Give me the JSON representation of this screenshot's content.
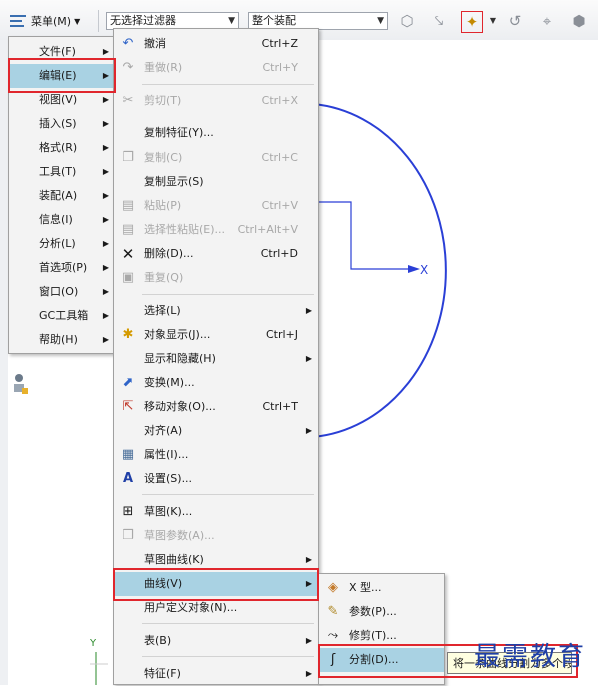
{
  "toolbar": {
    "menu_label": "菜单(M)",
    "filter_value": "无选择过滤器",
    "assembly_value": "整个装配",
    "icons": [
      "filter-cube-icon",
      "filter-arrow-icon",
      "select-filter-icon",
      "snap-arc-icon",
      "snap-point-icon",
      "snap-node-icon",
      "view-cube-icon"
    ]
  },
  "main_menu": {
    "items": [
      {
        "label": "文件(F)",
        "submenu": true
      },
      {
        "label": "编辑(E)",
        "submenu": true,
        "selected": true
      },
      {
        "label": "视图(V)",
        "submenu": true
      },
      {
        "label": "插入(S)",
        "submenu": true
      },
      {
        "label": "格式(R)",
        "submenu": true
      },
      {
        "label": "工具(T)",
        "submenu": true
      },
      {
        "label": "装配(A)",
        "submenu": true
      },
      {
        "label": "信息(I)",
        "submenu": true
      },
      {
        "label": "分析(L)",
        "submenu": true
      },
      {
        "label": "首选项(P)",
        "submenu": true
      },
      {
        "label": "窗口(O)",
        "submenu": true
      },
      {
        "label": "GC工具箱",
        "submenu": true
      },
      {
        "label": "帮助(H)",
        "submenu": true
      }
    ]
  },
  "edit_menu": {
    "items": [
      {
        "label": "撤消",
        "shortcut": "Ctrl+Z",
        "icon": "undo-icon"
      },
      {
        "label": "重做(R)",
        "shortcut": "Ctrl+Y",
        "icon": "redo-icon",
        "disabled": true
      },
      {
        "label": "剪切(T)",
        "shortcut": "Ctrl+X",
        "icon": "scissors-icon",
        "disabled": true
      },
      {
        "label": "复制特征(Y)...",
        "shortcut": "",
        "icon": ""
      },
      {
        "label": "复制(C)",
        "shortcut": "Ctrl+C",
        "icon": "copy-icon",
        "disabled": true
      },
      {
        "label": "复制显示(S)",
        "shortcut": "",
        "icon": ""
      },
      {
        "label": "粘贴(P)",
        "shortcut": "Ctrl+V",
        "icon": "paste-icon",
        "disabled": true
      },
      {
        "label": "选择性粘贴(E)...",
        "shortcut": "Ctrl+Alt+V",
        "icon": "paste-special-icon",
        "disabled": true
      },
      {
        "label": "删除(D)...",
        "shortcut": "Ctrl+D",
        "icon": "delete-x-icon"
      },
      {
        "label": "重复(Q)",
        "shortcut": "",
        "icon": "repeat-icon",
        "disabled": true
      },
      {
        "label": "选择(L)",
        "shortcut": "",
        "icon": "",
        "submenu": true
      },
      {
        "label": "对象显示(J)...",
        "shortcut": "Ctrl+J",
        "icon": "object-display-icon"
      },
      {
        "label": "显示和隐藏(H)",
        "shortcut": "",
        "icon": "",
        "submenu": true
      },
      {
        "label": "变换(M)...",
        "shortcut": "",
        "icon": "transform-icon"
      },
      {
        "label": "移动对象(O)...",
        "shortcut": "Ctrl+T",
        "icon": "move-object-icon"
      },
      {
        "label": "对齐(A)",
        "shortcut": "",
        "icon": "",
        "submenu": true
      },
      {
        "label": "属性(I)...",
        "shortcut": "",
        "icon": "properties-icon"
      },
      {
        "label": "设置(S)...",
        "shortcut": "",
        "icon": "settings-text-icon"
      },
      {
        "label": "草图(K)...",
        "shortcut": "",
        "icon": "sketch-icon"
      },
      {
        "label": "草图参数(A)...",
        "shortcut": "",
        "icon": "sketch-param-icon",
        "disabled": true
      },
      {
        "label": "草图曲线(K)",
        "shortcut": "",
        "icon": "",
        "submenu": true
      },
      {
        "label": "曲线(V)",
        "shortcut": "",
        "icon": "",
        "submenu": true,
        "selected": true
      },
      {
        "label": "用户定义对象(N)...",
        "shortcut": "",
        "icon": ""
      },
      {
        "label": "表(B)",
        "shortcut": "",
        "icon": "",
        "submenu": true
      },
      {
        "label": "特征(F)",
        "shortcut": "",
        "icon": "",
        "submenu": true
      }
    ]
  },
  "curve_menu": {
    "items": [
      {
        "label": "X 型...",
        "icon": "x-type-curve-icon"
      },
      {
        "label": "参数(P)...",
        "icon": "parameters-icon"
      },
      {
        "label": "修剪(T)...",
        "icon": "trim-curve-icon"
      },
      {
        "label": "分割(D)...",
        "icon": "divide-curve-icon",
        "selected": true
      }
    ]
  },
  "tooltip": {
    "text": "将一条曲线分割为多个段"
  },
  "canvas": {
    "axis_x": "X",
    "axis_y": "Y"
  },
  "watermark": "最需教育",
  "colors": {
    "highlight": "#a9d2e3",
    "annotation_box": "#e0262d",
    "curve": "#2a3fd6"
  }
}
